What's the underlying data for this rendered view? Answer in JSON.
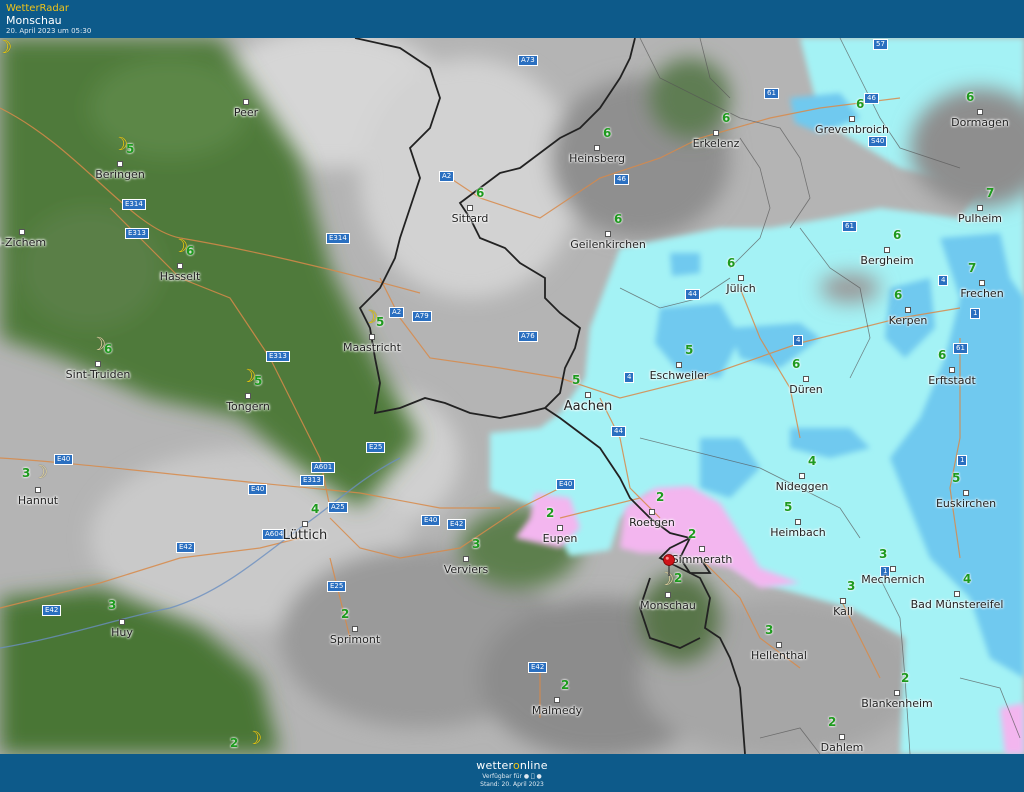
{
  "header": {
    "brand": "WetterRadar",
    "location": "Monschau",
    "timestamp": "20. April 2023 um 05:30"
  },
  "footer": {
    "logo_part1": "wetter",
    "logo_o": "o",
    "logo_part2": "nline",
    "available": "Verfügbar für",
    "stand": "Stand: 20. April 2023"
  },
  "colors": {
    "header_bg": "#0d5a8a",
    "forest": "#4f7a3a",
    "rain_light": "#a4f2f5",
    "rain_medium": "#6fc9ef",
    "mixed_precip": "#f3b6ef",
    "temperature": "#1e9a1e",
    "moon": "#f5d400",
    "marker": "#d0141a"
  },
  "marker": {
    "label": "Monschau",
    "icon": "map-pin-icon"
  },
  "cities": [
    {
      "name": "Peer",
      "temp": ""
    },
    {
      "name": "Beringen",
      "temp": "5"
    },
    {
      "name": "l-Zichem",
      "temp": ""
    },
    {
      "name": "Hasselt",
      "temp": "6"
    },
    {
      "name": "Sint-Truiden",
      "temp": "6"
    },
    {
      "name": "Tongern",
      "temp": "5"
    },
    {
      "name": "Maastricht",
      "temp": "5"
    },
    {
      "name": "Sittard",
      "temp": "6"
    },
    {
      "name": "Heinsberg",
      "temp": "6"
    },
    {
      "name": "Erkelenz",
      "temp": "6"
    },
    {
      "name": "Grevenbroich",
      "temp": "6"
    },
    {
      "name": "Dormagen",
      "temp": "6"
    },
    {
      "name": "Pulheim",
      "temp": "7"
    },
    {
      "name": "Geilenkirchen",
      "temp": "6"
    },
    {
      "name": "Bergheim",
      "temp": "6"
    },
    {
      "name": "Jülich",
      "temp": "6"
    },
    {
      "name": "Frechen",
      "temp": "7"
    },
    {
      "name": "Kerpen",
      "temp": "6"
    },
    {
      "name": "Eschweiler",
      "temp": "5"
    },
    {
      "name": "Düren",
      "temp": "6"
    },
    {
      "name": "Erftstadt",
      "temp": "6"
    },
    {
      "name": "Aachen",
      "temp": "5"
    },
    {
      "name": "Hannut",
      "temp": "3"
    },
    {
      "name": "Lüttich",
      "temp": "4"
    },
    {
      "name": "Nideggen",
      "temp": "4"
    },
    {
      "name": "Euskirchen",
      "temp": "5"
    },
    {
      "name": "Eupen",
      "temp": "2"
    },
    {
      "name": "Roetgen",
      "temp": "2"
    },
    {
      "name": "Heimbach",
      "temp": "5"
    },
    {
      "name": "Simmerath",
      "temp": "2"
    },
    {
      "name": "Verviers",
      "temp": "3"
    },
    {
      "name": "Mechernich",
      "temp": "3"
    },
    {
      "name": "Monschau",
      "temp": "2"
    },
    {
      "name": "Huy",
      "temp": "3"
    },
    {
      "name": "Sprimont",
      "temp": "2"
    },
    {
      "name": "Kall",
      "temp": "3"
    },
    {
      "name": "Bad Münstereifel",
      "temp": "4"
    },
    {
      "name": "Hellenthal",
      "temp": "3"
    },
    {
      "name": "Blankenheim",
      "temp": "2"
    },
    {
      "name": "Malmedy",
      "temp": "2"
    },
    {
      "name": "Dahlem",
      "temp": "2"
    },
    {
      "name": "",
      "temp": "2"
    }
  ],
  "roads": [
    "A73",
    "57",
    "61",
    "46",
    "S40",
    "A2",
    "46",
    "E314",
    "E313",
    "E314",
    "61",
    "4",
    "A2",
    "A79",
    "44",
    "A76",
    "1",
    "E313",
    "4",
    "4",
    "61",
    "E25",
    "44",
    "1",
    "E40",
    "A601",
    "E313",
    "E40",
    "E40",
    "A25",
    "E42",
    "E42",
    "A604",
    "E40",
    "E25",
    "E42",
    "E42",
    "1"
  ]
}
